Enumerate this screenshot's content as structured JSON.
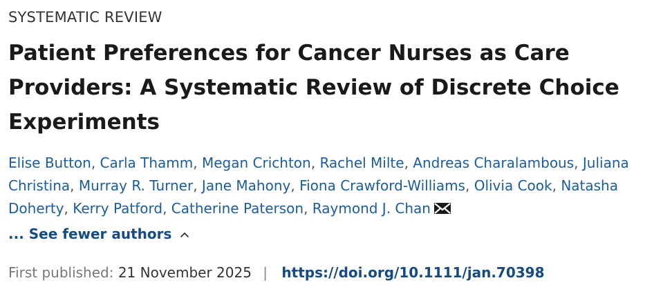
{
  "article": {
    "type": "SYSTEMATIC REVIEW",
    "title": "Patient Preferences for Cancer Nurses as Care Providers: A Systematic Review of Discrete Choice Experiments",
    "authors": [
      "Elise Button",
      "Carla Thamm",
      "Megan Crichton",
      "Rachel Milte",
      "Andreas Charalambous",
      "Juliana Christina",
      "Murray R. Turner",
      "Jane Mahony",
      "Fiona Crawford-Williams",
      "Olivia Cook",
      "Natasha Doherty",
      "Kerry Patford",
      "Catherine Paterson",
      "Raymond J. Chan"
    ],
    "author_separator": ", ",
    "corresponding_icon": "mail-icon",
    "toggle_label": "... See fewer authors",
    "toggle_icon": "chevron-up-icon",
    "first_published_label": "First published:",
    "first_published_date": "21 November 2025",
    "meta_separator": "|",
    "doi": "https://doi.org/10.1111/jan.70398"
  },
  "colors": {
    "link": "#1a5c9e",
    "link_strong": "#154a85",
    "text": "#1a1a1a",
    "muted": "#777777"
  }
}
